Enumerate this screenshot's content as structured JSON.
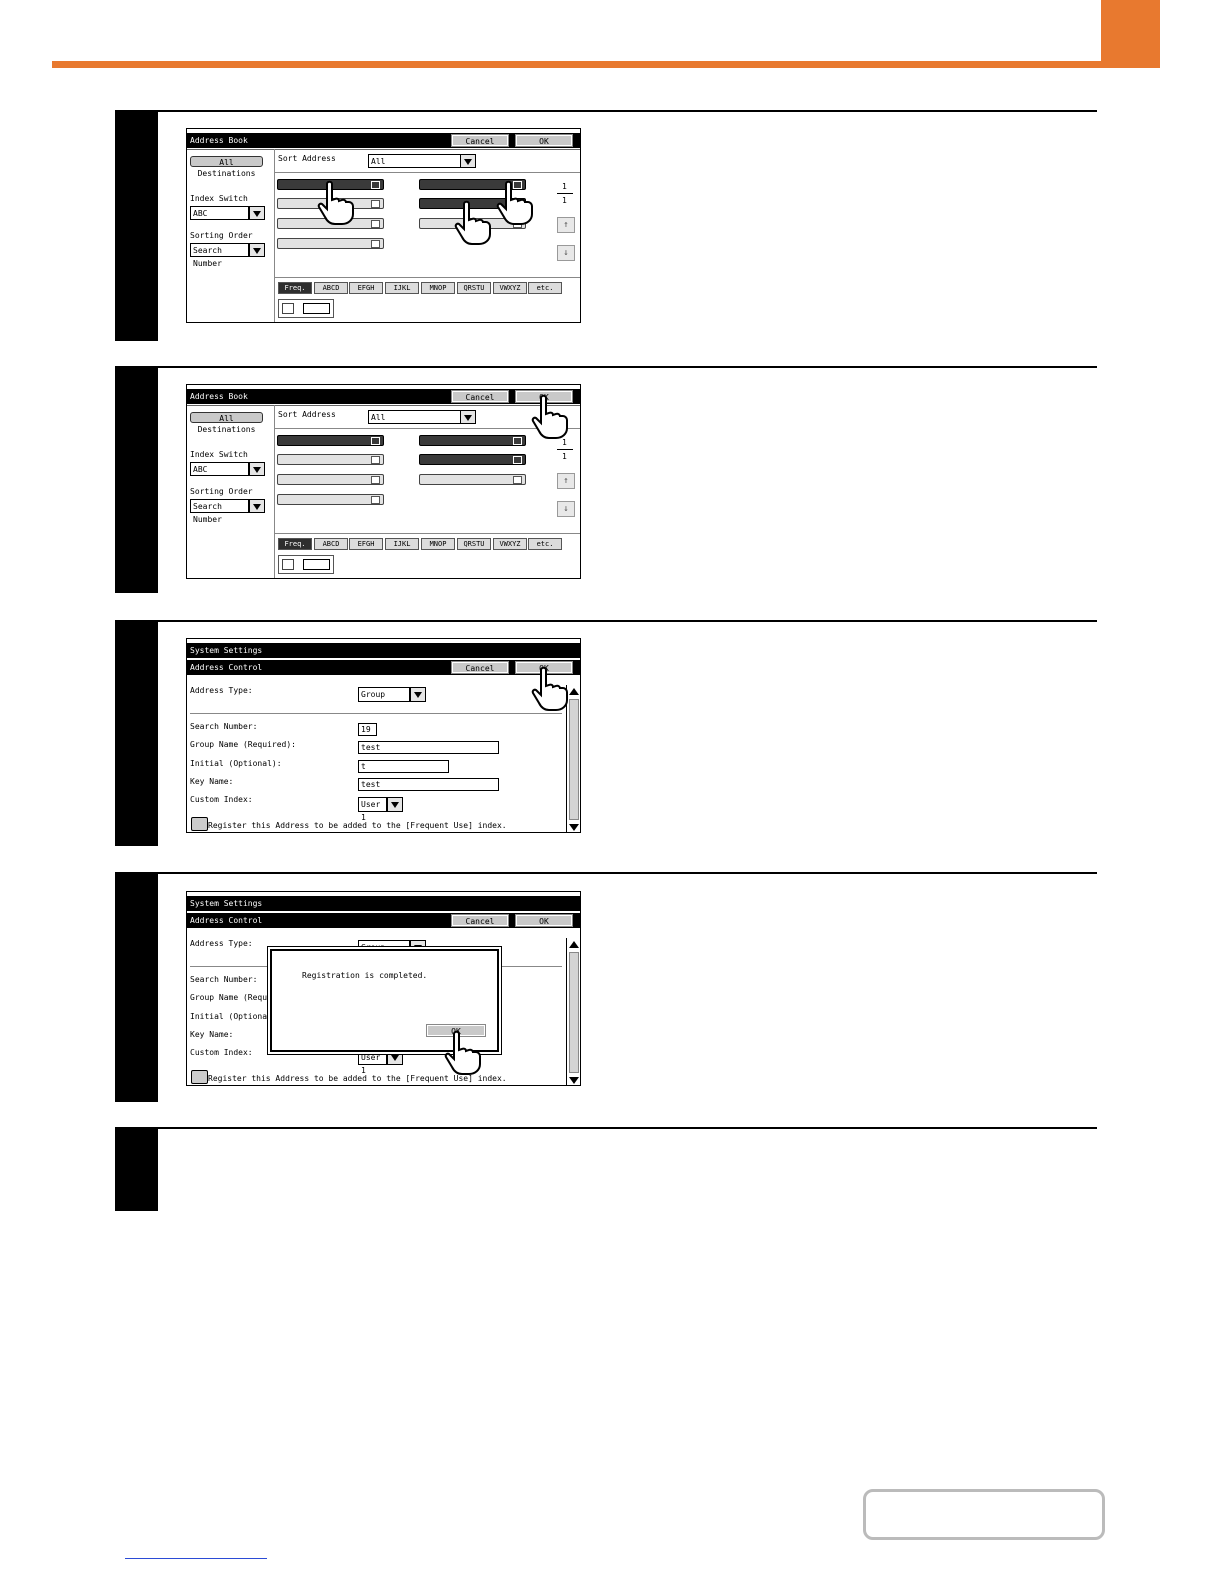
{
  "address_book": {
    "title": "Address Book",
    "cancel": "Cancel",
    "ok": "OK",
    "all_destinations": "All Destinations",
    "sort_address_label": "Sort Address",
    "sort_address_value": "All",
    "index_switch_label": "Index Switch",
    "index_switch_value": "ABC",
    "sorting_order_label": "Sorting Order",
    "sorting_order_value": "Search Number",
    "page_current": "1",
    "page_total": "1",
    "page_up": "↑",
    "page_down": "↓",
    "index_tabs": [
      "Freq.",
      "ABCD",
      "EFGH",
      "IJKL",
      "MNOP",
      "QRSTU",
      "VWXYZ",
      "etc."
    ]
  },
  "address_control": {
    "system_title": "System Settings",
    "title": "Address Control",
    "cancel": "Cancel",
    "ok": "OK",
    "address_type_label": "Address Type:",
    "address_type_value": "Group",
    "search_number_label": "Search Number:",
    "search_number_value": "19",
    "group_name_label": "Group Name (Required):",
    "group_name_value": "test",
    "initial_label": "Initial (Optional):",
    "initial_value": "t",
    "key_name_label": "Key Name:",
    "key_name_value": "test",
    "custom_index_label": "Custom Index:",
    "custom_index_value": "User 1",
    "register_label": "Register this Address to be added to the [Frequent Use] index.",
    "group_name_label_cut": "Group Name (Required",
    "address_type_value_cut": "Group"
  },
  "dialog": {
    "message": "Registration is completed.",
    "ok": "OK"
  },
  "colors": {
    "accent": "#e8792f"
  }
}
